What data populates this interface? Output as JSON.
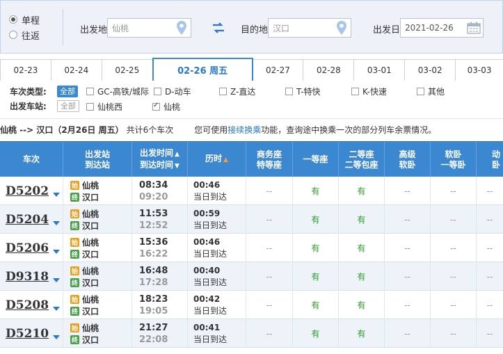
{
  "search": {
    "trip_types": [
      {
        "label": "单程",
        "selected": true
      },
      {
        "label": "往返",
        "selected": false
      }
    ],
    "from_label": "出发地",
    "from_value": "仙桃",
    "to_label": "目的地",
    "to_value": "汉口",
    "date_label": "出发日",
    "date_value": "2021-02-26"
  },
  "date_tabs": [
    "02-23",
    "02-24",
    "02-25",
    "02-26 周五",
    "02-27",
    "02-28",
    "03-01",
    "03-02",
    "03-03"
  ],
  "active_tab": 3,
  "filters": {
    "type_title": "车次类型:",
    "type_all": "全部",
    "types": [
      {
        "label": "GC-高铁/城际",
        "checked": false
      },
      {
        "label": "D-动车",
        "checked": false
      },
      {
        "label": "Z-直达",
        "checked": false
      },
      {
        "label": "T-特快",
        "checked": false
      },
      {
        "label": "K-快速",
        "checked": false
      },
      {
        "label": "其他",
        "checked": false
      }
    ],
    "station_title": "出发车站:",
    "station_all": "全部",
    "stations": [
      {
        "label": "仙桃西",
        "checked": false
      },
      {
        "label": "仙桃",
        "checked": true
      }
    ]
  },
  "info": {
    "route": "仙桃 --> 汉口（2月26日  周五）",
    "count": "共计6个车次",
    "hint_prefix": "您可使用",
    "hint_link": "接续换乘",
    "hint_suffix": "功能，查询途中换乘一次的部分列车余票情况。"
  },
  "table": {
    "headers": {
      "train": "车次",
      "station_1": "出发站",
      "station_2": "到达站",
      "time_1": "出发时间",
      "time_2": "到达时间",
      "duration": "历时",
      "business_1": "商务座",
      "business_2": "特等座",
      "first": "一等座",
      "second_1": "二等座",
      "second_2": "二等包座",
      "soft_1": "高级",
      "soft_2": "软卧",
      "sleeper_1": "软卧",
      "sleeper_2": "一等卧",
      "motor": "动卧"
    },
    "start_badge": "始",
    "end_badge": "终",
    "rows": [
      {
        "train": "D5202",
        "from": "仙桃",
        "to": "汉口",
        "dep": "08:34",
        "arr": "09:20",
        "duration": "00:46",
        "arrive": "当日到达",
        "business": "--",
        "first": "有",
        "second": "有",
        "soft_high": "--",
        "soft": "--",
        "motor": "--"
      },
      {
        "train": "D5204",
        "from": "仙桃",
        "to": "汉口",
        "dep": "11:53",
        "arr": "12:52",
        "duration": "00:59",
        "arrive": "当日到达",
        "business": "--",
        "first": "有",
        "second": "有",
        "soft_high": "--",
        "soft": "--",
        "motor": "--"
      },
      {
        "train": "D5206",
        "from": "仙桃",
        "to": "汉口",
        "dep": "15:36",
        "arr": "16:22",
        "duration": "00:46",
        "arrive": "当日到达",
        "business": "--",
        "first": "有",
        "second": "有",
        "soft_high": "--",
        "soft": "--",
        "motor": "--"
      },
      {
        "train": "D9318",
        "from": "仙桃",
        "to": "汉口",
        "dep": "16:48",
        "arr": "17:28",
        "duration": "00:40",
        "arrive": "当日到达",
        "business": "--",
        "first": "有",
        "second": "有",
        "soft_high": "--",
        "soft": "--",
        "motor": "--"
      },
      {
        "train": "D5208",
        "from": "仙桃",
        "to": "汉口",
        "dep": "18:23",
        "arr": "19:05",
        "duration": "00:42",
        "arrive": "当日到达",
        "business": "--",
        "first": "有",
        "second": "有",
        "soft_high": "--",
        "soft": "--",
        "motor": "--"
      },
      {
        "train": "D5210",
        "from": "仙桃",
        "to": "汉口",
        "dep": "21:27",
        "arr": "22:08",
        "duration": "00:41",
        "arrive": "当日到达",
        "business": "--",
        "first": "有",
        "second": "有",
        "soft_high": "--",
        "soft": "--",
        "motor": "--"
      }
    ]
  },
  "colors": {
    "accent": "#3b87d0",
    "available": "#2a9a2a",
    "link": "#2a78c8"
  }
}
